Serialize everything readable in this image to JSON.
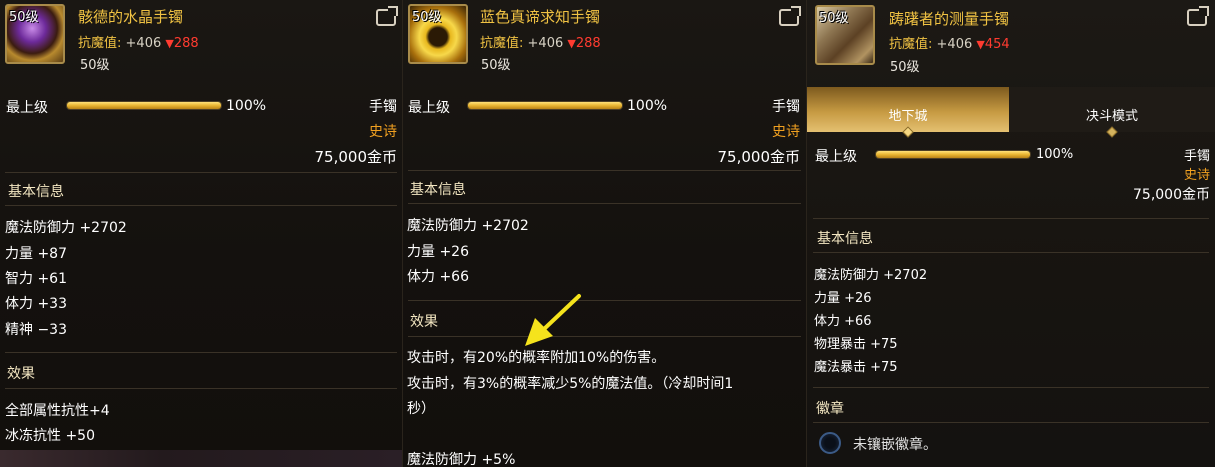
{
  "colors": {
    "gold": "#f0c243",
    "red": "#ff3b30",
    "epic": "#f0a020",
    "arrow": "#f5e31c"
  },
  "panels": [
    {
      "level_badge": "50级",
      "name": "骸德的水晶手镯",
      "resist_label": "抗魔值:",
      "resist_value": "+406",
      "resist_diff": "288",
      "sub_level": "50级",
      "upgrade_label": "最上级",
      "upgrade_progress": 1.0,
      "upgrade_pct": "100%",
      "type": "手镯",
      "rarity": "史诗",
      "price": "75,000金币",
      "basic_title": "基本信息",
      "stats": [
        "魔法防御力 +2702",
        "力量 +87",
        "智力 +61",
        "体力 +33",
        "精神 −33"
      ],
      "effect_title": "效果",
      "effects": [
        "全部属性抗性+4",
        "冰冻抗性 +50"
      ],
      "icons": {
        "item": "purple-crystal-bracelet-icon",
        "share": "share-icon"
      }
    },
    {
      "level_badge": "50级",
      "name": "蓝色真谛求知手镯",
      "resist_label": "抗魔值:",
      "resist_value": "+406",
      "resist_diff": "288",
      "sub_level": "50级",
      "upgrade_label": "最上级",
      "upgrade_progress": 1.0,
      "upgrade_pct": "100%",
      "type": "手镯",
      "rarity": "史诗",
      "price": "75,000金币",
      "basic_title": "基本信息",
      "stats": [
        "魔法防御力 +2702",
        "力量 +26",
        "体力 +66"
      ],
      "effect_title": "效果",
      "effects": [
        "攻击时，有20%的概率附加10%的伤害。",
        "攻击时，有3%的概率减少5%的魔法值。（冷却时间1",
        "秒）",
        "魔法防御力 +5%"
      ],
      "icons": {
        "item": "gold-emerald-bracelet-icon",
        "share": "share-icon",
        "arrow": "yellow-arrow-icon"
      }
    },
    {
      "level_badge": "50级",
      "name": "踌躇者的测量手镯",
      "resist_label": "抗魔值:",
      "resist_value": "+406",
      "resist_diff": "454",
      "sub_level": "50级",
      "tabs": [
        "地下城",
        "决斗模式"
      ],
      "upgrade_label": "最上级",
      "upgrade_progress": 1.0,
      "upgrade_pct": "100%",
      "type": "手镯",
      "rarity": "史诗",
      "price": "75,000金币",
      "basic_title": "基本信息",
      "stats": [
        "魔法防御力 +2702",
        "力量 +26",
        "体力 +66",
        "物理暴击 +75",
        "魔法暴击 +75"
      ],
      "emblem_title": "徽章",
      "emblem_text": "未镶嵌徽章。",
      "icons": {
        "item": "brass-measure-bracelet-icon",
        "share": "share-icon",
        "emblem": "empty-emblem-slot-icon"
      }
    }
  ]
}
